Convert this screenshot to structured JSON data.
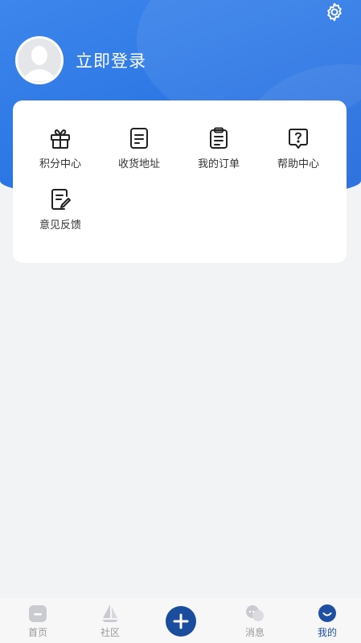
{
  "profile": {
    "login_label": "立即登录"
  },
  "menu": [
    {
      "label": "积分中心",
      "icon": "gift-icon"
    },
    {
      "label": "收货地址",
      "icon": "document-list-icon"
    },
    {
      "label": "我的订单",
      "icon": "clipboard-icon"
    },
    {
      "label": "帮助中心",
      "icon": "help-bubble-icon"
    },
    {
      "label": "意见反馈",
      "icon": "feedback-edit-icon"
    }
  ],
  "tabbar": [
    {
      "label": "首页",
      "icon": "home-icon"
    },
    {
      "label": "社区",
      "icon": "sail-icon"
    },
    {
      "label": "",
      "icon": "plus-icon"
    },
    {
      "label": "消息",
      "icon": "chat-icon"
    },
    {
      "label": "我的",
      "icon": "smile-icon",
      "active": true
    }
  ],
  "colors": {
    "header_blue": "#2f79e6",
    "active_tab": "#1f4fa3",
    "background": "#f2f3f5"
  }
}
